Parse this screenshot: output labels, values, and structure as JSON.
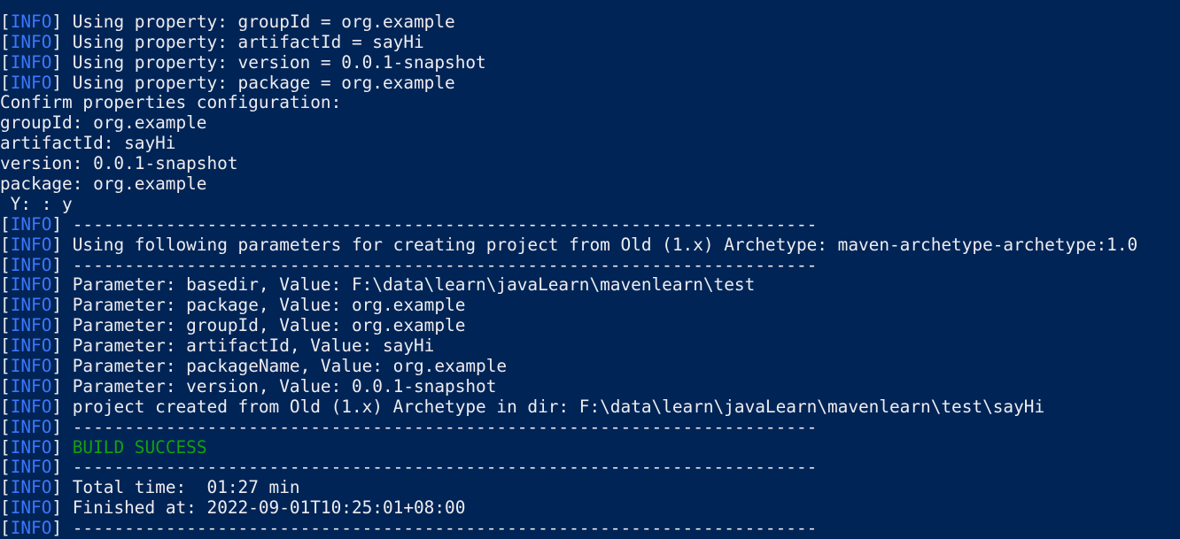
{
  "theme": {
    "background": "#012456",
    "foreground": "#eeedf0",
    "info_tag_color": "#3b78ff",
    "success_color": "#13a10e"
  },
  "lines": [
    {
      "tag": "",
      "text": ""
    },
    {
      "tag": "INFO",
      "text": " Using property: groupId = org.example"
    },
    {
      "tag": "INFO",
      "text": " Using property: artifactId = sayHi"
    },
    {
      "tag": "INFO",
      "text": " Using property: version = 0.0.1-snapshot"
    },
    {
      "tag": "INFO",
      "text": " Using property: package = org.example"
    },
    {
      "tag": "",
      "text": "Confirm properties configuration:"
    },
    {
      "tag": "",
      "text": "groupId: org.example"
    },
    {
      "tag": "",
      "text": "artifactId: sayHi"
    },
    {
      "tag": "",
      "text": "version: 0.0.1-snapshot"
    },
    {
      "tag": "",
      "text": "package: org.example"
    },
    {
      "tag": "",
      "text": " Y: : y"
    },
    {
      "tag": "INFO",
      "text": " ------------------------------------------------------------------------"
    },
    {
      "tag": "INFO",
      "text": " Using following parameters for creating project from Old (1.x) Archetype: maven-archetype-archetype:1.0"
    },
    {
      "tag": "INFO",
      "text": " ------------------------------------------------------------------------"
    },
    {
      "tag": "INFO",
      "text": " Parameter: basedir, Value: F:\\data\\learn\\javaLearn\\mavenlearn\\test"
    },
    {
      "tag": "INFO",
      "text": " Parameter: package, Value: org.example"
    },
    {
      "tag": "INFO",
      "text": " Parameter: groupId, Value: org.example"
    },
    {
      "tag": "INFO",
      "text": " Parameter: artifactId, Value: sayHi"
    },
    {
      "tag": "INFO",
      "text": " Parameter: packageName, Value: org.example"
    },
    {
      "tag": "INFO",
      "text": " Parameter: version, Value: 0.0.1-snapshot"
    },
    {
      "tag": "INFO",
      "text": " project created from Old (1.x) Archetype in dir: F:\\data\\learn\\javaLearn\\mavenlearn\\test\\sayHi"
    },
    {
      "tag": "INFO",
      "text": " ------------------------------------------------------------------------"
    },
    {
      "tag": "INFO",
      "text": " BUILD SUCCESS",
      "success": true
    },
    {
      "tag": "INFO",
      "text": " ------------------------------------------------------------------------"
    },
    {
      "tag": "INFO",
      "text": " Total time:  01:27 min"
    },
    {
      "tag": "INFO",
      "text": " Finished at: 2022-09-01T10:25:01+08:00"
    },
    {
      "tag": "INFO",
      "text": " ------------------------------------------------------------------------"
    }
  ]
}
